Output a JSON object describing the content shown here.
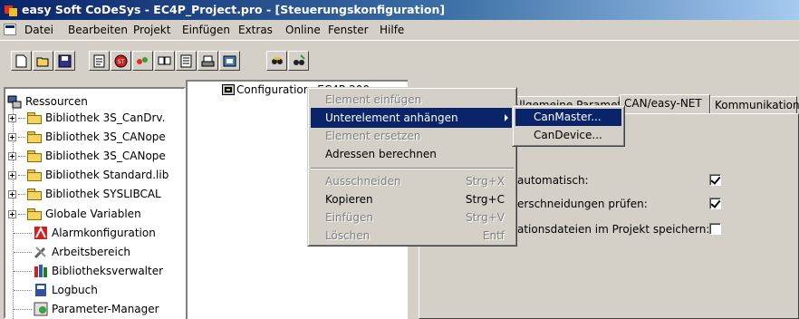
{
  "window": {
    "title": "easy Soft CoDeSys - EC4P_Project.pro - [Steuerungskonfiguration]"
  },
  "menu": [
    "Datei",
    "Bearbeiten",
    "Projekt",
    "Einfügen",
    "Extras",
    "Online",
    "Fenster",
    "Hilfe"
  ],
  "toolbar": {
    "buttons": [
      "new-file-icon",
      "open-folder-icon",
      "save-icon",
      "compile-icon",
      "stop-icon",
      "run-icon",
      "monitor-icon",
      "login-icon",
      "logout-icon",
      "find-icon",
      "replace-icon"
    ]
  },
  "tree": {
    "root": "Ressourcen",
    "items": [
      "Bibliothek 3S_CanDrv.",
      "Bibliothek 3S_CANope",
      "Bibliothek 3S_CANope",
      "Bibliothek Standard.lib",
      "Bibliothek SYSLIBCAL",
      "Globale Variablen",
      "Alarmkonfiguration",
      "Arbeitsbereich",
      "Bibliotheksverwalter",
      "Logbuch",
      "Parameter-Manager"
    ]
  },
  "config_node": "Configuration: EC4P-200",
  "tabs": [
    "Allgemeine Parameter",
    "CAN/easy-NET",
    "Kommunikation"
  ],
  "options": [
    {
      "label": "automatisch:",
      "checked": true
    },
    {
      "label": "erschneidungen prüfen:",
      "checked": true
    },
    {
      "label": "ationsdateien im Projekt speichern:",
      "checked": false
    }
  ],
  "context_menu": [
    {
      "label": "Element einfügen",
      "shortcut": "",
      "enabled": false
    },
    {
      "label": "Unterelement anhängen",
      "shortcut": "",
      "enabled": true,
      "selected": true,
      "submenu": true
    },
    {
      "label": "Element ersetzen",
      "shortcut": "",
      "enabled": false
    },
    {
      "label": "Adressen berechnen",
      "shortcut": "",
      "enabled": true
    },
    {
      "label": "Ausschneiden",
      "shortcut": "Strg+X",
      "enabled": false
    },
    {
      "label": "Kopieren",
      "shortcut": "Strg+C",
      "enabled": true
    },
    {
      "label": "Einfügen",
      "shortcut": "Strg+V",
      "enabled": false
    },
    {
      "label": "Löschen",
      "shortcut": "Entf",
      "enabled": false
    }
  ],
  "submenu": [
    {
      "label": "CanMaster...",
      "selected": true
    },
    {
      "label": "CanDevice...",
      "selected": false
    }
  ]
}
